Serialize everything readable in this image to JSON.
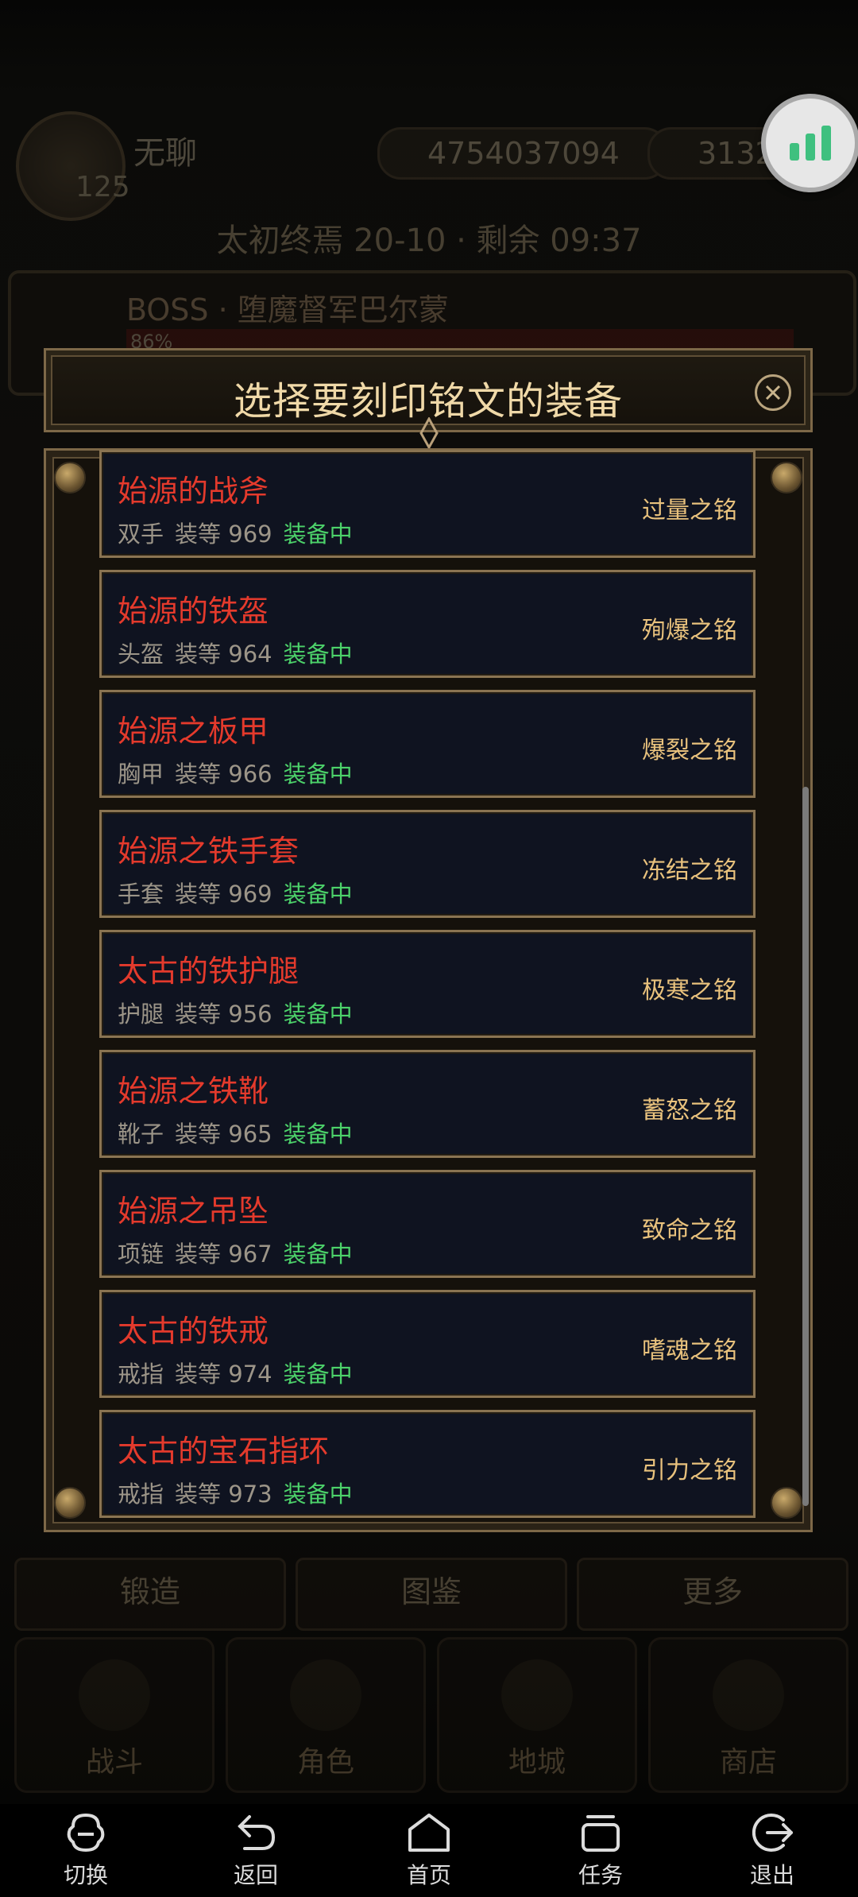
{
  "background": {
    "player_name": "无聊",
    "level": "125",
    "gold": "4754037094",
    "gems": "3132",
    "stage": "太初终焉 20-10 · 剩余 09:37",
    "boss_name": "BOSS · 堕魔督军巴尔蒙",
    "boss_hp_text": "86%",
    "tools": [
      "锻造",
      "图鉴",
      "更多"
    ],
    "nav_tabs": [
      "战斗",
      "角色",
      "地城",
      "商店"
    ]
  },
  "floating_button": {
    "icon": "bar-chart-icon"
  },
  "dialog": {
    "title": "选择要刻印铭文的装备",
    "items": [
      {
        "name": "始源的战斧",
        "slot": "双手",
        "level_label": "装等",
        "level": "969",
        "status": "装备中",
        "rune": "过量之铭"
      },
      {
        "name": "始源的铁盔",
        "slot": "头盔",
        "level_label": "装等",
        "level": "964",
        "status": "装备中",
        "rune": "殉爆之铭"
      },
      {
        "name": "始源之板甲",
        "slot": "胸甲",
        "level_label": "装等",
        "level": "966",
        "status": "装备中",
        "rune": "爆裂之铭"
      },
      {
        "name": "始源之铁手套",
        "slot": "手套",
        "level_label": "装等",
        "level": "969",
        "status": "装备中",
        "rune": "冻结之铭"
      },
      {
        "name": "太古的铁护腿",
        "slot": "护腿",
        "level_label": "装等",
        "level": "956",
        "status": "装备中",
        "rune": "极寒之铭"
      },
      {
        "name": "始源之铁靴",
        "slot": "靴子",
        "level_label": "装等",
        "level": "965",
        "status": "装备中",
        "rune": "蓄怒之铭"
      },
      {
        "name": "始源之吊坠",
        "slot": "项链",
        "level_label": "装等",
        "level": "967",
        "status": "装备中",
        "rune": "致命之铭"
      },
      {
        "name": "太古的铁戒",
        "slot": "戒指",
        "level_label": "装等",
        "level": "974",
        "status": "装备中",
        "rune": "嗜魂之铭"
      },
      {
        "name": "太古的宝石指环",
        "slot": "戒指",
        "level_label": "装等",
        "level": "973",
        "status": "装备中",
        "rune": "引力之铭"
      }
    ],
    "colors": {
      "item_name": "#e43a2c",
      "equipped": "#4cd26a",
      "rune": "#e9c27d",
      "title": "#f0d9a8"
    }
  },
  "system_nav": {
    "buttons": [
      {
        "label": "切换",
        "icon": "switch-icon"
      },
      {
        "label": "返回",
        "icon": "back-icon"
      },
      {
        "label": "首页",
        "icon": "home-icon"
      },
      {
        "label": "任务",
        "icon": "tasks-icon"
      },
      {
        "label": "退出",
        "icon": "exit-icon"
      }
    ]
  }
}
